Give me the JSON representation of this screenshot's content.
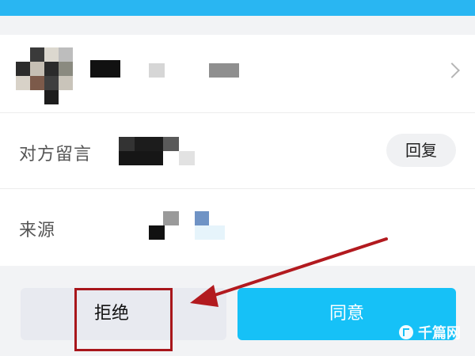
{
  "profile": {
    "chevron_icon": "chevron-right-icon"
  },
  "message_row": {
    "label": "对方留言",
    "reply_label": "回复"
  },
  "source_row": {
    "label": "来源"
  },
  "actions": {
    "reject_label": "拒绝",
    "agree_label": "同意"
  },
  "watermark": {
    "text": "千篇网"
  },
  "colors": {
    "top_bar": "#29b6f2",
    "agree_button": "#16c1f7",
    "reject_button": "#e8eaf0",
    "highlight": "#a8161b"
  }
}
